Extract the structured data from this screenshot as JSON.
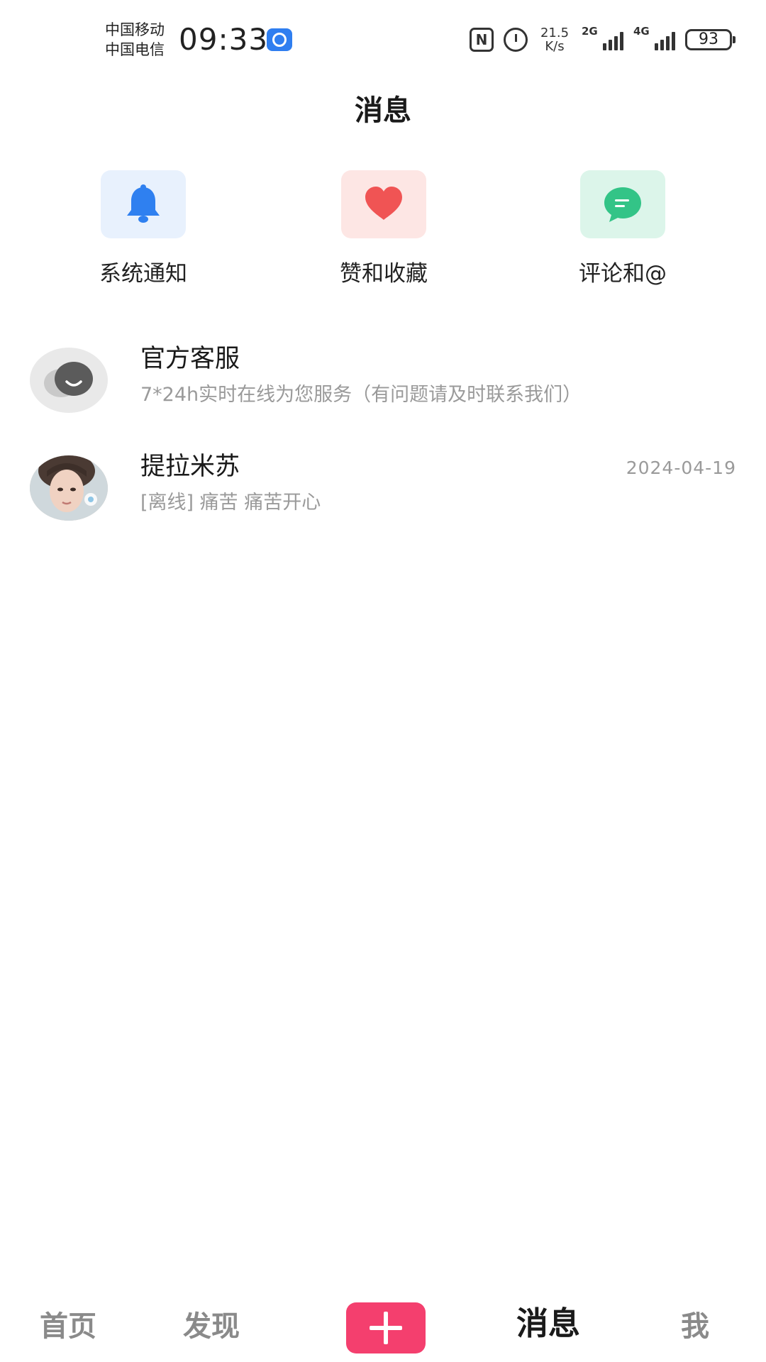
{
  "status_bar": {
    "carrier_1": "中国移动",
    "carrier_2": "中国电信",
    "time": "09:33",
    "net_speed_value": "21.5",
    "net_speed_unit": "K/s",
    "signal_1_type": "2G",
    "signal_2_type": "4G",
    "battery": "93"
  },
  "header": {
    "title": "消息"
  },
  "quick_entries": [
    {
      "label": "系统通知",
      "icon": "bell-icon",
      "bg": "#e8f1fd",
      "color": "#2f80f0"
    },
    {
      "label": "赞和收藏",
      "icon": "heart-icon",
      "bg": "#fde6e4",
      "color": "#f05454"
    },
    {
      "label": "评论和@",
      "icon": "comment-icon",
      "bg": "#dcf5ea",
      "color": "#33c487"
    }
  ],
  "conversations": [
    {
      "name": "官方客服",
      "preview": "7*24h实时在线为您服务（有问题请及时联系我们）",
      "date": "",
      "avatar": "service-chat-icon"
    },
    {
      "name": "提拉米苏",
      "preview": "[离线] 痛苦 痛苦开心",
      "date": "2024-04-19",
      "avatar": "user-photo"
    }
  ],
  "bottom_nav": {
    "home": "首页",
    "discover": "发现",
    "messages": "消息",
    "me": "我",
    "active": "messages",
    "accent_color": "#f43f6e"
  }
}
